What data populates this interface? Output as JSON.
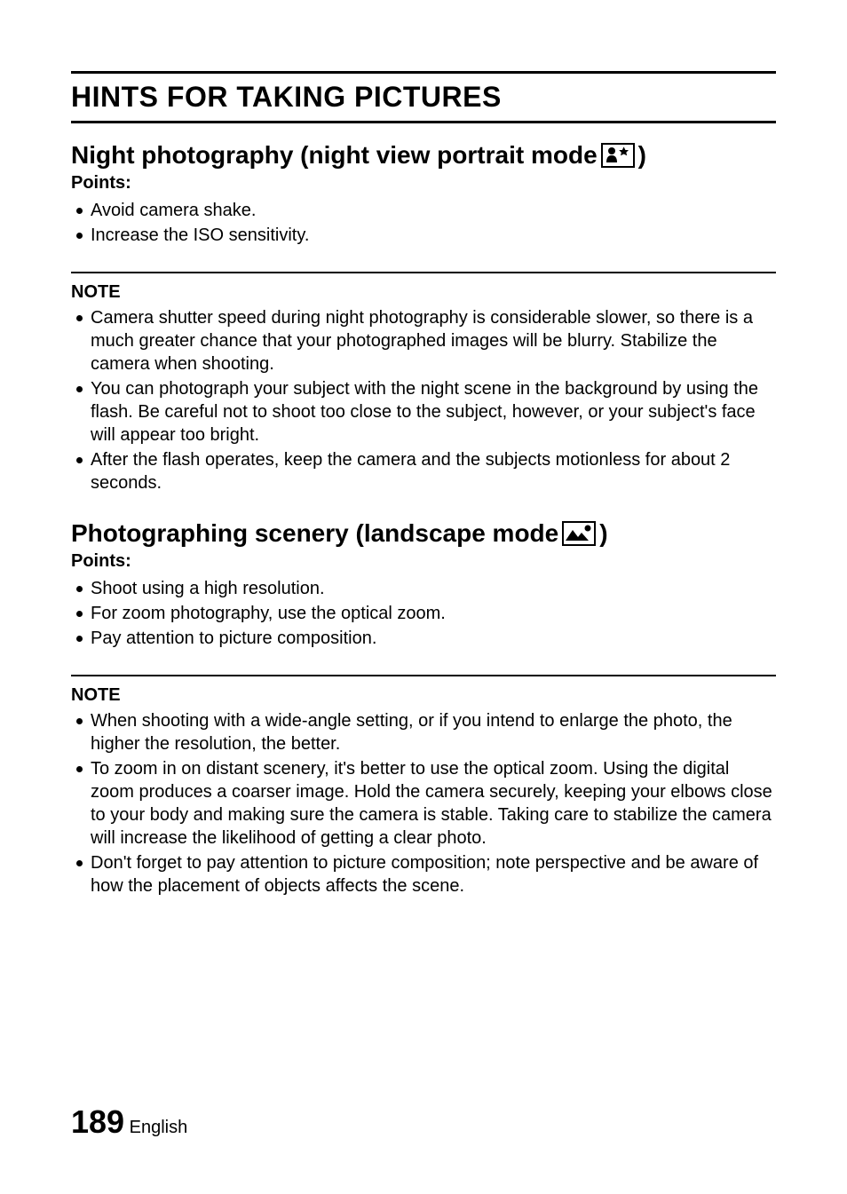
{
  "page_title": "HINTS FOR TAKING PICTURES",
  "sections": [
    {
      "heading_prefix": "Night photography (night view portrait mode ",
      "heading_suffix": ")",
      "icon": "night-portrait-mode-icon",
      "points_label": "Points:",
      "points": [
        "Avoid camera shake.",
        "Increase the ISO sensitivity."
      ],
      "note_label": "NOTE",
      "notes": [
        "Camera shutter speed during night photography is considerable slower, so there is a much greater chance that your photographed images will be blurry. Stabilize the camera when shooting.",
        "You can photograph your subject with the night scene in the background by using the flash. Be careful not to shoot too close to the subject, however, or your subject's face will appear too bright.",
        "After the flash operates, keep the camera and the subjects motionless for about 2 seconds."
      ]
    },
    {
      "heading_prefix": "Photographing scenery (landscape mode ",
      "heading_suffix": ")",
      "icon": "landscape-mode-icon",
      "points_label": "Points:",
      "points": [
        "Shoot using a high resolution.",
        "For zoom photography, use the optical zoom.",
        "Pay attention to picture composition."
      ],
      "note_label": "NOTE",
      "notes": [
        "When shooting with a wide-angle setting, or if you intend to enlarge the photo, the higher the resolution, the better.",
        "To zoom in on distant scenery, it's better to use the optical zoom. Using the digital zoom produces a coarser image. Hold the camera securely, keeping your elbows close to your body and making sure the camera is stable. Taking care to stabilize the camera will increase the likelihood of getting a clear photo.",
        "Don't forget to pay attention to picture composition; note perspective and be aware of how the placement of objects affects the scene."
      ]
    }
  ],
  "page_number": "189",
  "page_language": "English"
}
